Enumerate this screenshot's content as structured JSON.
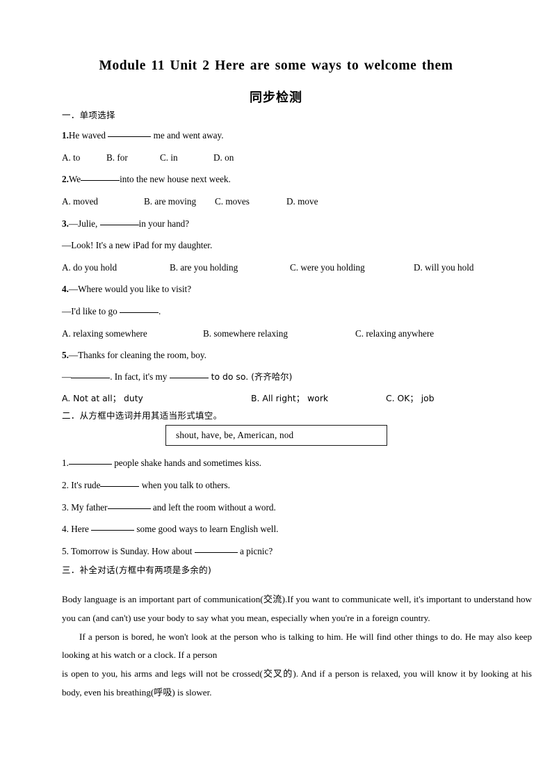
{
  "document": {
    "title": "Module  11 Unit 2 Here  are  some  ways  to  welcome  them",
    "subtitle": "同步检测"
  },
  "section1": {
    "heading": "一．单项选择",
    "questions": [
      {
        "number": "1.",
        "stem_before": "He waved ",
        "stem_after": " me and went away.",
        "options": [
          "A. to",
          "B. for",
          "C. in",
          "D. on"
        ]
      },
      {
        "number": "2.",
        "stem_before": "We",
        "stem_after": "into the new house next week.",
        "options": [
          "A. moved",
          "B. are moving",
          "C. moves",
          "D. move"
        ]
      },
      {
        "number": "3.",
        "stem_before": "—Julie,   ",
        "stem_after": "in your hand?",
        "stem_line2": "—Look! It's a new iPad for my daughter.",
        "options": [
          "A. do you hold",
          "B. are you holding",
          "C. were you holding",
          "D. will you hold"
        ]
      },
      {
        "number": "4.",
        "stem_line1": "—Where would you like to visit?",
        "stem_before": "—I'd like to go ",
        "stem_after": ".",
        "options": [
          "A. relaxing somewhere",
          "B. somewhere relaxing",
          "C. relaxing anywhere"
        ]
      },
      {
        "number": "5.",
        "stem_line1": "—Thanks for cleaning the room, boy.",
        "stem_before": "—",
        "stem_mid": ". In fact,   it's my ",
        "stem_after": " to do so. (齐齐哈尔)",
        "options": [
          "A. Not at all；  duty",
          "B. All right；  work",
          "C. OK；  job"
        ]
      }
    ]
  },
  "section2": {
    "heading": "二．从方框中选词并用其适当形式填空。",
    "word_bank": "shout,  have,  be,   American,   nod",
    "items": [
      {
        "number": "1.",
        "before": "",
        "after": " people shake hands and sometimes kiss."
      },
      {
        "number": "2.",
        "before": "It's rude",
        "after": " when you talk to others."
      },
      {
        "number": "3.",
        "before": "My father",
        "after": " and left the room without a word."
      },
      {
        "number": "4.",
        "before": "Here ",
        "after": " some good ways to learn English  well."
      },
      {
        "number": "5.",
        "before": "Tomorrow is Sunday. How about ",
        "after": " a picnic?"
      }
    ]
  },
  "section3": {
    "heading": "三．补全对话(方框中有两项是多余的)",
    "paragraphs": [
      "Body  language  is  an  important  part  of  communication(交流).If  you  want  to  communicate  well,  it's  important  to understand how you can (and can't) use your body to say what you mean, especially when you're in a foreign country.",
      "If a person is bored, he won't look at the person who is talking to him. He will  find other things to do. He may also keep looking  at his watch or a clock. If a person",
      "is open to you, his arms and legs  will not be crossed(交叉的). And if a person is relaxed, you will know it by looking at his body, even his breathing(呼吸) is slower."
    ]
  }
}
